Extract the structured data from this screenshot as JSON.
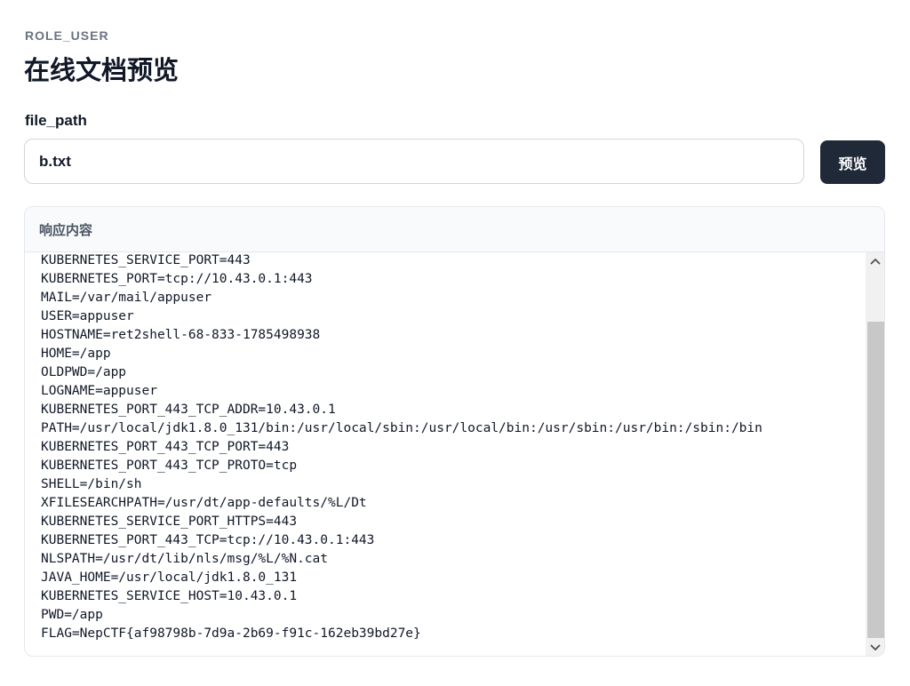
{
  "header": {
    "role": "ROLE_USER",
    "title": "在线文档预览"
  },
  "form": {
    "file_path_label": "file_path",
    "file_path_value": "b.txt",
    "preview_button_label": "预览"
  },
  "response": {
    "title": "响应内容",
    "content": "KUBERNETES_SERVICE_PORT=443\nKUBERNETES_PORT=tcp://10.43.0.1:443\nMAIL=/var/mail/appuser\nUSER=appuser\nHOSTNAME=ret2shell-68-833-1785498938\nHOME=/app\nOLDPWD=/app\nLOGNAME=appuser\nKUBERNETES_PORT_443_TCP_ADDR=10.43.0.1\nPATH=/usr/local/jdk1.8.0_131/bin:/usr/local/sbin:/usr/local/bin:/usr/sbin:/usr/bin:/sbin:/bin\nKUBERNETES_PORT_443_TCP_PORT=443\nKUBERNETES_PORT_443_TCP_PROTO=tcp\nSHELL=/bin/sh\nXFILESEARCHPATH=/usr/dt/app-defaults/%L/Dt\nKUBERNETES_SERVICE_PORT_HTTPS=443\nKUBERNETES_PORT_443_TCP=tcp://10.43.0.1:443\nNLSPATH=/usr/dt/lib/nls/msg/%L/%N.cat\nJAVA_HOME=/usr/local/jdk1.8.0_131\nKUBERNETES_SERVICE_HOST=10.43.0.1\nPWD=/app\nFLAG=NepCTF{af98798b-7d9a-2b69-f91c-162eb39bd27e}"
  },
  "icons": {
    "scroll_up": "chevron-up-icon",
    "scroll_down": "chevron-down-icon"
  },
  "colors": {
    "button_bg": "#1f2937",
    "panel_header_bg": "#f9fafb",
    "muted_text": "#6b7280"
  }
}
